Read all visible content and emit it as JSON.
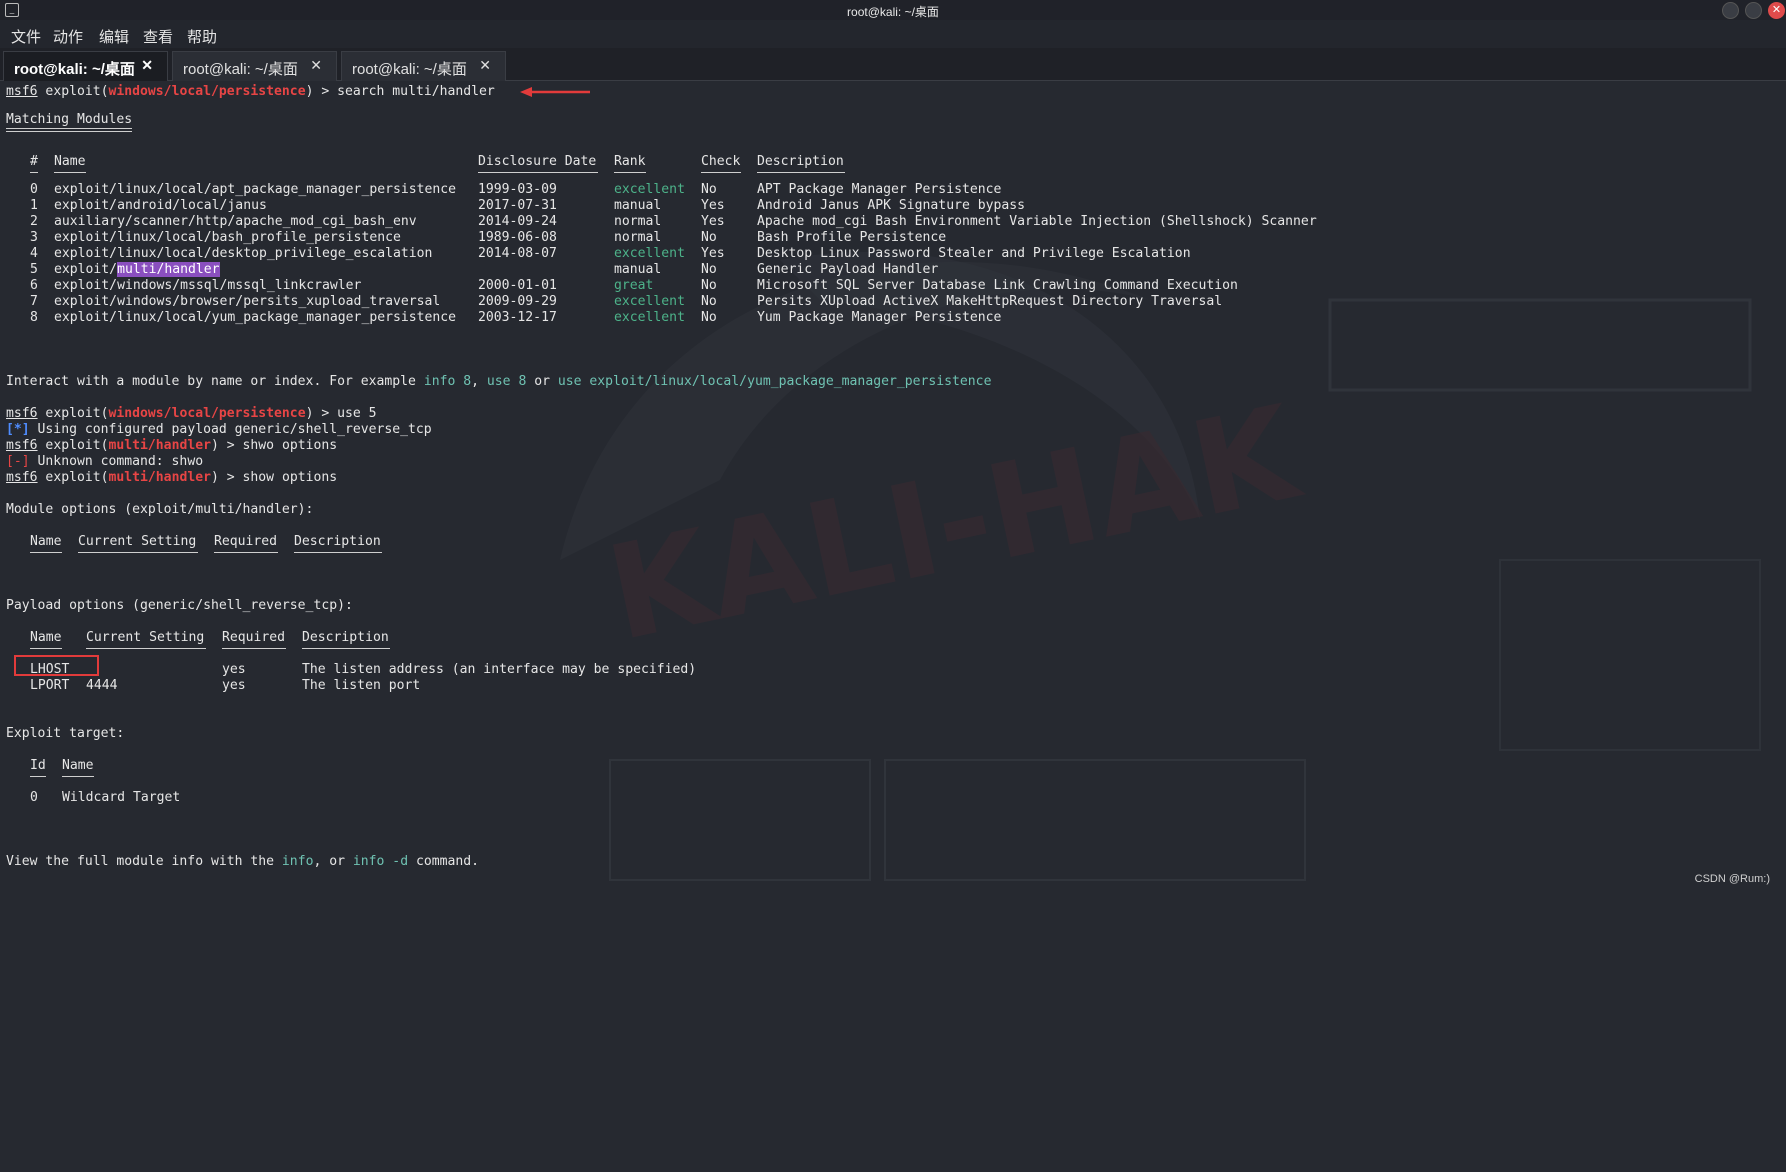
{
  "window": {
    "title": "root@kali: ~/桌面",
    "icon": "terminal-icon"
  },
  "menu": [
    "文件",
    "动作",
    "编辑",
    "查看",
    "帮助"
  ],
  "tabs": [
    {
      "label": "root@kali: ~/桌面",
      "active": true
    },
    {
      "label": "root@kali: ~/桌面",
      "active": false
    },
    {
      "label": "root@kali: ~/桌面",
      "active": false
    }
  ],
  "terminal": {
    "prompt_prefix": "msf6",
    "module_persistence": "windows/local/persistence",
    "module_handler": "multi/handler",
    "cmd_search": " > search multi/handler",
    "matching_title": "Matching Modules",
    "headers": [
      "#",
      "Name",
      "Disclosure Date",
      "Rank",
      "Check",
      "Description"
    ],
    "modules": [
      {
        "num": "0",
        "name": "exploit/linux/local/apt_package_manager_persistence",
        "date": "1999-03-09",
        "rank": "excellent",
        "check": "No",
        "desc": "APT Package Manager Persistence"
      },
      {
        "num": "1",
        "name": "exploit/android/local/janus",
        "date": "2017-07-31",
        "rank": "manual",
        "check": "Yes",
        "desc": "Android Janus APK Signature bypass"
      },
      {
        "num": "2",
        "name": "auxiliary/scanner/http/apache_mod_cgi_bash_env",
        "date": "2014-09-24",
        "rank": "normal",
        "check": "Yes",
        "desc": "Apache mod_cgi Bash Environment Variable Injection (Shellshock) Scanner"
      },
      {
        "num": "3",
        "name": "exploit/linux/local/bash_profile_persistence",
        "date": "1989-06-08",
        "rank": "normal",
        "check": "No",
        "desc": "Bash Profile Persistence"
      },
      {
        "num": "4",
        "name": "exploit/linux/local/desktop_privilege_escalation",
        "date": "2014-08-07",
        "rank": "excellent",
        "check": "Yes",
        "desc": "Desktop Linux Password Stealer and Privilege Escalation"
      },
      {
        "num": "5",
        "name_prefix": "exploit/",
        "name_hl": "multi/handler",
        "date": "",
        "rank": "manual",
        "check": "No",
        "desc": "Generic Payload Handler"
      },
      {
        "num": "6",
        "name": "exploit/windows/mssql/mssql_linkcrawler",
        "date": "2000-01-01",
        "rank": "great",
        "check": "No",
        "desc": "Microsoft SQL Server Database Link Crawling Command Execution"
      },
      {
        "num": "7",
        "name": "exploit/windows/browser/persits_xupload_traversal",
        "date": "2009-09-29",
        "rank": "excellent",
        "check": "No",
        "desc": "Persits XUpload ActiveX MakeHttpRequest Directory Traversal"
      },
      {
        "num": "8",
        "name": "exploit/linux/local/yum_package_manager_persistence",
        "date": "2003-12-17",
        "rank": "excellent",
        "check": "No",
        "desc": "Yum Package Manager Persistence"
      }
    ],
    "interact": {
      "a": "Interact with a module by name or index. For example ",
      "b": "info 8",
      "c": ", ",
      "d": "use 8",
      "e": " or ",
      "f": "use exploit/linux/local/yum_package_manager_persistence"
    },
    "cmd_use": " > use 5",
    "info_tag": "[*]",
    "info_msg": " Using configured payload generic/shell_reverse_tcp",
    "cmd_shwo": " > shwo options",
    "err_tag": "[-]",
    "err_msg": " Unknown command: shwo",
    "cmd_show": " > show options",
    "exploit_open": " exploit(",
    "exploit_close": ")",
    "module_opts_title": "Module options (exploit/multi/handler):",
    "module_opts_headers": [
      "Name",
      "Current Setting",
      "Required",
      "Description"
    ],
    "payload_opts_title": "Payload options (generic/shell_reverse_tcp):",
    "payload_opts_headers": [
      "Name",
      "Current Setting",
      "Required",
      "Description"
    ],
    "payload_rows": [
      {
        "name": "LHOST",
        "setting": "",
        "required": "yes",
        "desc": "The listen address (an interface may be specified)"
      },
      {
        "name": "LPORT",
        "setting": "4444",
        "required": "yes",
        "desc": "The listen port"
      }
    ],
    "target_title": "Exploit target:",
    "target_headers": [
      "Id",
      "Name"
    ],
    "target_rows": [
      {
        "id": "0",
        "name": "Wildcard Target"
      }
    ],
    "footer": {
      "a": "View the full module info with the ",
      "b": "info",
      "c": ", or ",
      "d": "info -d",
      "e": " command."
    }
  },
  "watermark": "CSDN @Rum:)"
}
